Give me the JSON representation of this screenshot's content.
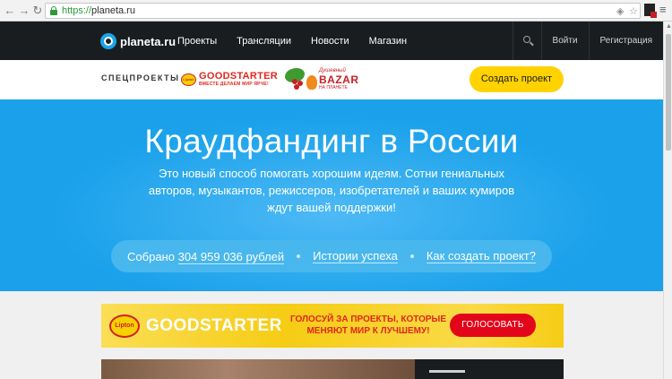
{
  "browser": {
    "url_scheme": "https://",
    "url_host": "planeta.ru",
    "back_icon": "back-arrow-icon",
    "forward_icon": "forward-arrow-icon",
    "reload_icon": "reload-icon",
    "security_icon": "lock-icon"
  },
  "header": {
    "logo_text": "planeta.ru",
    "nav": [
      "Проекты",
      "Трансляции",
      "Новости",
      "Магазин"
    ],
    "search_icon": "search-icon",
    "login": "Войти",
    "register": "Регистрация"
  },
  "spec": {
    "label": "СПЕЦПРОЕКТЫ",
    "goodstarter": {
      "badge": "Lipton",
      "title": "GOODSTARTER",
      "subtitle": "ВМЕСТЕ ДЕЛАЕМ МИР ЯРЧЕ!"
    },
    "bazar": {
      "top": "Душевный",
      "title": "BAZAR",
      "bottom": "НА ПЛАНЕТЕ"
    },
    "create_button": "Создать проект"
  },
  "hero": {
    "title": "Краудфандинг в России",
    "description": "Это новый способ помогать хорошим идеям. Сотни гениальных авторов, музыкантов, режиссеров, изобретателей и ваших кумиров ждут вашей поддержки!",
    "collected_prefix": "Собрано",
    "collected_amount": "304 959 036 рублей",
    "success_stories": "Истории успеха",
    "how_to": "Как создать проект?"
  },
  "banner": {
    "badge": "Lipton",
    "title": "GOODSTARTER",
    "text": "ГОЛОСУЙ ЗА ПРОЕКТЫ, КОТОРЫЕ МЕНЯЮТ МИР К ЛУЧШЕМУ!",
    "button": "ГОЛОСОВАТЬ"
  },
  "colors": {
    "header_bg": "#1a1d20",
    "hero_bg": "#1aa1ea",
    "accent_yellow": "#ffd200",
    "brand_red": "#e1261c"
  }
}
